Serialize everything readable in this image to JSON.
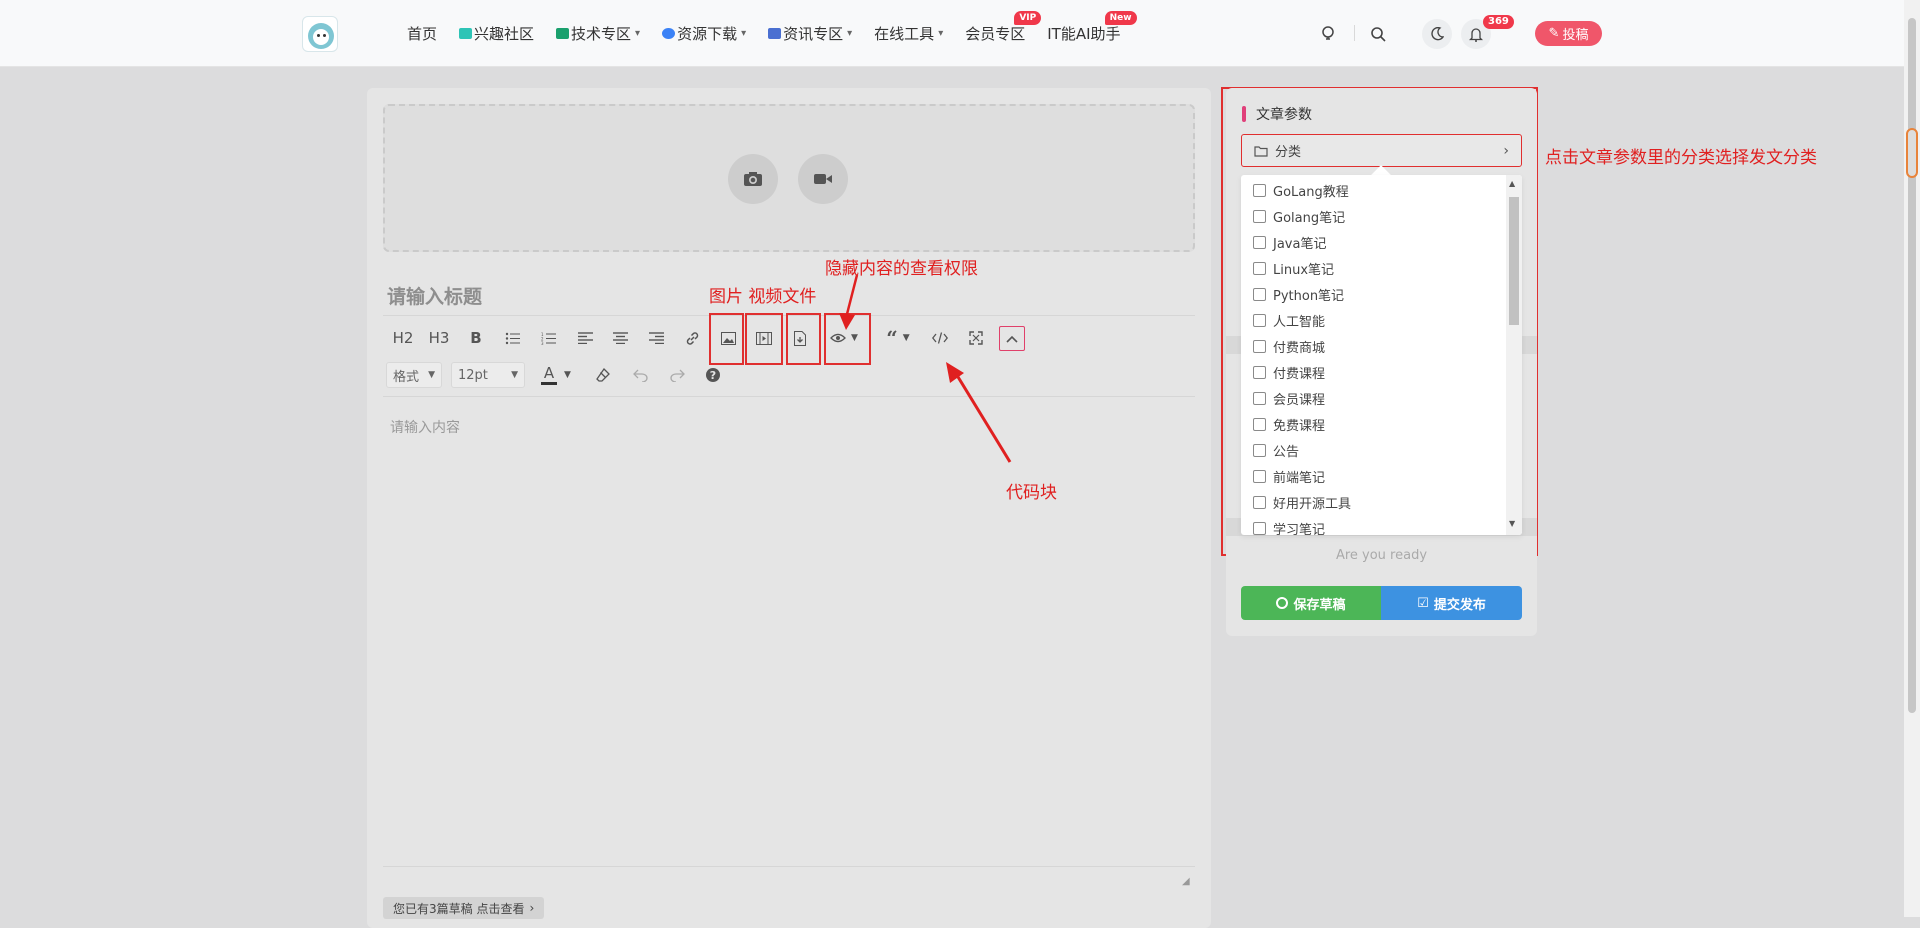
{
  "nav": {
    "items": [
      {
        "label": "首页"
      },
      {
        "label": "兴趣社区",
        "icon": "community-icon",
        "icon_color": "#2ec4b6"
      },
      {
        "label": "技术专区",
        "icon": "tech-icon",
        "icon_color": "#1aa06d",
        "dropdown": true
      },
      {
        "label": "资源下载",
        "icon": "database-icon",
        "icon_color": "#3b82f6",
        "dropdown": true
      },
      {
        "label": "资讯专区",
        "icon": "news-icon",
        "icon_color": "#4a6fd1",
        "dropdown": true
      },
      {
        "label": "在线工具",
        "dropdown": true
      },
      {
        "label": "会员专区",
        "badge": "VIP"
      },
      {
        "label": "IT能AI助手",
        "badge": "New"
      }
    ],
    "notification_count": "369",
    "post_label": "投稿"
  },
  "editor": {
    "title_placeholder": "请输入标题",
    "format_label": "格式",
    "fontsize_label": "12pt",
    "toolbar": {
      "h2": "H2",
      "h3": "H3",
      "bold": "B",
      "font_color": "A"
    },
    "content_placeholder": "请输入内容",
    "drafts_label": "您已有3篇草稿 点击查看"
  },
  "annotations": {
    "media": "图片 视频文件",
    "hidden": "隐藏内容的查看权限",
    "code": "代码块",
    "category": "点击文章参数里的分类选择发文分类"
  },
  "side": {
    "title": "文章参数",
    "category_label": "分类",
    "categories": [
      "GoLang教程",
      "Golang笔记",
      "Java笔记",
      "Linux笔记",
      "Python笔记",
      "人工智能",
      "付费商城",
      "付费课程",
      "会员课程",
      "免费课程",
      "公告",
      "前端笔记",
      "好用开源工具",
      "学习笔记"
    ],
    "ready_text": "Are you ready",
    "save_label": "保存草稿",
    "submit_label": "提交发布"
  },
  "colors": {
    "accent_pink": "#f0566a",
    "annotation_red": "#e02020",
    "save_green": "#4cb657",
    "submit_blue": "#3d92e1"
  }
}
